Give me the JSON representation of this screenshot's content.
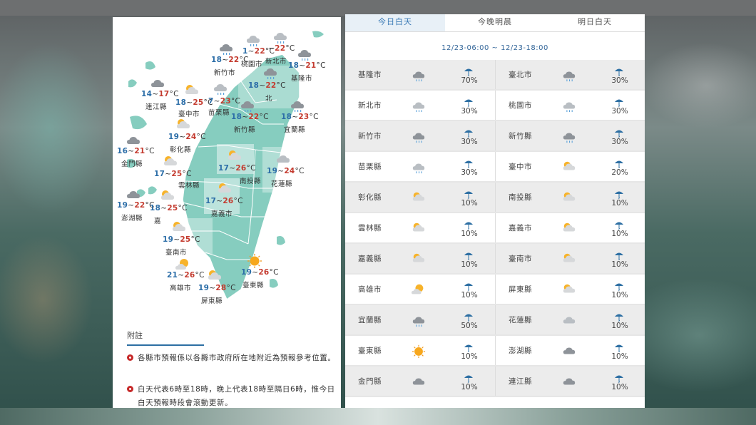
{
  "tabs": [
    "今日白天",
    "今晚明晨",
    "明日白天"
  ],
  "date_range": "12/23-06:00 ~ 12/23-18:00",
  "rows": [
    [
      {
        "name": "基隆市",
        "icon": "rain-cloud",
        "pct": "70%"
      },
      {
        "name": "臺北市",
        "icon": "rain-cloud",
        "pct": "30%"
      }
    ],
    [
      {
        "name": "新北市",
        "icon": "rain-light",
        "pct": "30%"
      },
      {
        "name": "桃園市",
        "icon": "rain-light",
        "pct": "30%"
      }
    ],
    [
      {
        "name": "新竹市",
        "icon": "rain-cloud",
        "pct": "30%"
      },
      {
        "name": "新竹縣",
        "icon": "rain-cloud",
        "pct": "30%"
      }
    ],
    [
      {
        "name": "苗栗縣",
        "icon": "rain-light",
        "pct": "30%"
      },
      {
        "name": "臺中市",
        "icon": "partly-cloudy",
        "pct": "20%"
      }
    ],
    [
      {
        "name": "彰化縣",
        "icon": "partly-cloudy",
        "pct": "10%"
      },
      {
        "name": "南投縣",
        "icon": "partly-cloudy",
        "pct": "10%"
      }
    ],
    [
      {
        "name": "雲林縣",
        "icon": "partly-cloudy",
        "pct": "10%"
      },
      {
        "name": "嘉義市",
        "icon": "partly-cloudy",
        "pct": "10%"
      }
    ],
    [
      {
        "name": "嘉義縣",
        "icon": "partly-cloudy",
        "pct": "10%"
      },
      {
        "name": "臺南市",
        "icon": "partly-cloudy",
        "pct": "10%"
      }
    ],
    [
      {
        "name": "高雄市",
        "icon": "sun-cloud",
        "pct": "10%"
      },
      {
        "name": "屏東縣",
        "icon": "partly-cloudy",
        "pct": "10%"
      }
    ],
    [
      {
        "name": "宜蘭縣",
        "icon": "rain-cloud",
        "pct": "50%"
      },
      {
        "name": "花蓮縣",
        "icon": "cloudy-light",
        "pct": "10%"
      }
    ],
    [
      {
        "name": "臺東縣",
        "icon": "sunny",
        "pct": "10%"
      },
      {
        "name": "澎湖縣",
        "icon": "cloudy",
        "pct": "10%"
      }
    ],
    [
      {
        "name": "金門縣",
        "icon": "cloudy",
        "pct": "10%"
      },
      {
        "name": "連江縣",
        "icon": "cloudy",
        "pct": "10%"
      }
    ]
  ],
  "map_items": [
    {
      "lo": "18",
      "hi": "22",
      "unit": "°C",
      "label": "新竹市",
      "icon": "rain-cloud"
    },
    {
      "lo": "1",
      "hi": "22",
      "unit": "°C",
      "label": "桃園市",
      "icon": "rain-light"
    },
    {
      "lo": "",
      "hi": "22",
      "unit": "°C",
      "label": "新北市",
      "icon": "rain-light"
    },
    {
      "lo": "18",
      "hi": "21",
      "unit": "°C",
      "label": "基隆市",
      "icon": "rain-cloud"
    },
    {
      "lo": "18",
      "hi": "22",
      "unit": "°C",
      "label": "北",
      "icon": "rain-cloud"
    },
    {
      "lo": "14",
      "hi": "17",
      "unit": "°C",
      "label": "連江縣",
      "icon": "cloudy"
    },
    {
      "lo": "18",
      "hi": "25",
      "unit": "°C",
      "label": "臺中市",
      "icon": "partly-cloudy"
    },
    {
      "lo": "7",
      "hi": "23",
      "unit": "°C",
      "label": "苗栗縣",
      "icon": "rain-light"
    },
    {
      "lo": "18",
      "hi": "22",
      "unit": "°C",
      "label": "新竹縣",
      "icon": "rain-cloud"
    },
    {
      "lo": "18",
      "hi": "23",
      "unit": "°C",
      "label": "宜蘭縣",
      "icon": "rain-cloud"
    },
    {
      "lo": "19",
      "hi": "24",
      "unit": "°C",
      "label": "彰化縣",
      "icon": "partly-cloudy"
    },
    {
      "lo": "16",
      "hi": "21",
      "unit": "°C",
      "label": "金門縣",
      "icon": "cloudy"
    },
    {
      "lo": "17",
      "hi": "26",
      "unit": "°C",
      "label": "南投縣",
      "icon": "partly-cloudy"
    },
    {
      "lo": "19",
      "hi": "24",
      "unit": "°C",
      "label": "花蓮縣",
      "icon": "cloudy-light"
    },
    {
      "lo": "17",
      "hi": "25",
      "unit": "°C",
      "label": "雲林縣",
      "icon": "partly-cloudy"
    },
    {
      "lo": "17",
      "hi": "26",
      "unit": "°C",
      "label": "嘉義市",
      "icon": "partly-cloudy"
    },
    {
      "lo": "19",
      "hi": "22",
      "unit": "°C",
      "label": "澎湖縣",
      "icon": "cloudy"
    },
    {
      "lo": "18",
      "hi": "25",
      "unit": "°C",
      "label": "嘉",
      "icon": "partly-cloudy"
    },
    {
      "lo": "19",
      "hi": "25",
      "unit": "°C",
      "label": "臺南市",
      "icon": "partly-cloudy"
    },
    {
      "lo": "21",
      "hi": "26",
      "unit": "°C",
      "label": "高雄市",
      "icon": "sun-cloud"
    },
    {
      "lo": "19",
      "hi": "28",
      "unit": "°C",
      "label": "屏東縣",
      "icon": "partly-cloudy"
    },
    {
      "lo": "19",
      "hi": "26",
      "unit": "°C",
      "label": "臺東縣",
      "icon": "sunny"
    }
  ],
  "notes": {
    "title": "附註",
    "items": [
      "各縣市預報係以各縣市政府所在地附近為預報參考位置。",
      "白天代表6時至18時，晚上代表18時至隔日6時，惟今日白天預報時段會滾動更新。"
    ]
  },
  "colors": {
    "land": "#7fc9bb",
    "border": "#ffffff",
    "accent": "#3a7ab5",
    "lo_temp": "#2c6ea8",
    "hi_temp": "#c43b2f"
  }
}
